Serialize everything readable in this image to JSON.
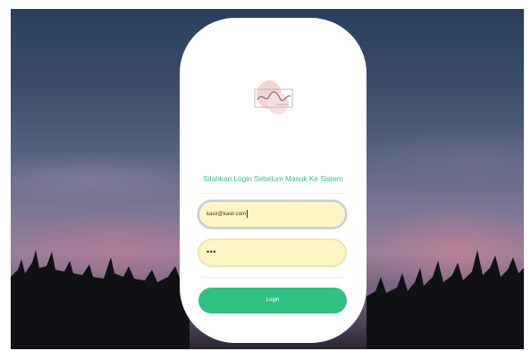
{
  "login": {
    "subtitle": "Silahkan Login Sebelum Masuk Ke Sistem",
    "email_value": "kasir@kasir.com",
    "password_value": "•••",
    "button_label": "Login"
  },
  "colors": {
    "accent": "#2fc082",
    "input_bg": "#fdf6c3",
    "card_bg": "#ffffff"
  },
  "icons": {
    "logo": "handwritten-logo"
  }
}
